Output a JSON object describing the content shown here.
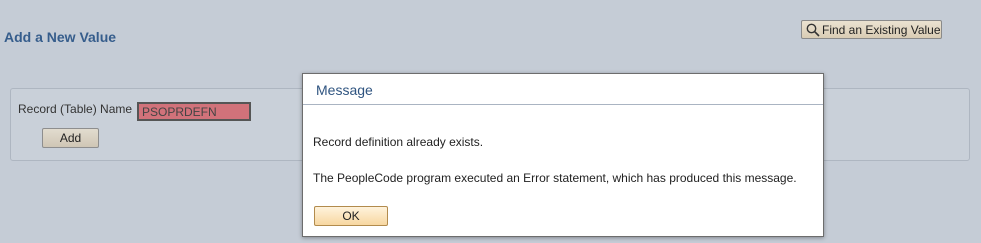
{
  "page": {
    "title": "Add a New Value"
  },
  "toolbar": {
    "find_label": "Find an Existing Value",
    "find_icon": "search-icon"
  },
  "form": {
    "field_label": "Record (Table) Name",
    "field_value": "PSOPRDEFN",
    "add_label": "Add"
  },
  "modal": {
    "title": "Message",
    "line1": "Record definition already exists.",
    "line2": "The PeopleCode program executed an Error statement, which has produced this message.",
    "ok_label": "OK"
  },
  "colors": {
    "accent": "#365d8c",
    "error_field": "#d1727a",
    "background": "#c5ccd6"
  }
}
